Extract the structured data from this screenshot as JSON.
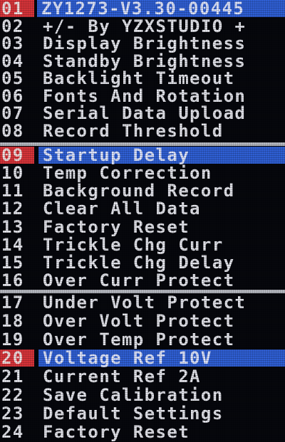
{
  "panels": [
    {
      "rows": [
        {
          "num": "01",
          "label": "ZY1273-V3.30-00445",
          "selected": true,
          "header": true
        },
        {
          "num": "02",
          "label": "+/- By YZXSTUDIO +"
        },
        {
          "num": "03",
          "label": "Display Brightness"
        },
        {
          "num": "04",
          "label": "Standby Brightness"
        },
        {
          "num": "05",
          "label": "Backlight Timeout"
        },
        {
          "num": "06",
          "label": "Fonts And Rotation"
        },
        {
          "num": "07",
          "label": "Serial Data Upload"
        },
        {
          "num": "08",
          "label": "Record Threshold"
        }
      ]
    },
    {
      "rows": [
        {
          "num": "09",
          "label": "Startup Delay",
          "selected": true
        },
        {
          "num": "10",
          "label": "Temp Correction"
        },
        {
          "num": "11",
          "label": "Background Record"
        },
        {
          "num": "12",
          "label": "Clear All Data"
        },
        {
          "num": "13",
          "label": "Factory Reset"
        },
        {
          "num": "14",
          "label": "Trickle Chg Curr"
        },
        {
          "num": "15",
          "label": "Trickle Chg Delay"
        },
        {
          "num": "16",
          "label": "Over  Curr Protect"
        }
      ]
    },
    {
      "rows": [
        {
          "num": "17",
          "label": "Under Volt Protect"
        },
        {
          "num": "18",
          "label": "Over  Volt Protect"
        },
        {
          "num": "19",
          "label": "Over  Temp Protect"
        },
        {
          "num": "20",
          "label": "Voltage Ref 10V",
          "selected": true
        },
        {
          "num": "21",
          "label": "Current Ref 2A"
        },
        {
          "num": "22",
          "label": "Save Calibration"
        },
        {
          "num": "23",
          "label": "Default Settings"
        },
        {
          "num": "24",
          "label": "Factory Reset"
        }
      ]
    }
  ],
  "colors": {
    "background": "#06070c",
    "text": "#e6e7ee",
    "selected_number_bg": "#d8343a",
    "selected_label_bg": "#2f5fd4",
    "divider": "#b9bcc4"
  }
}
